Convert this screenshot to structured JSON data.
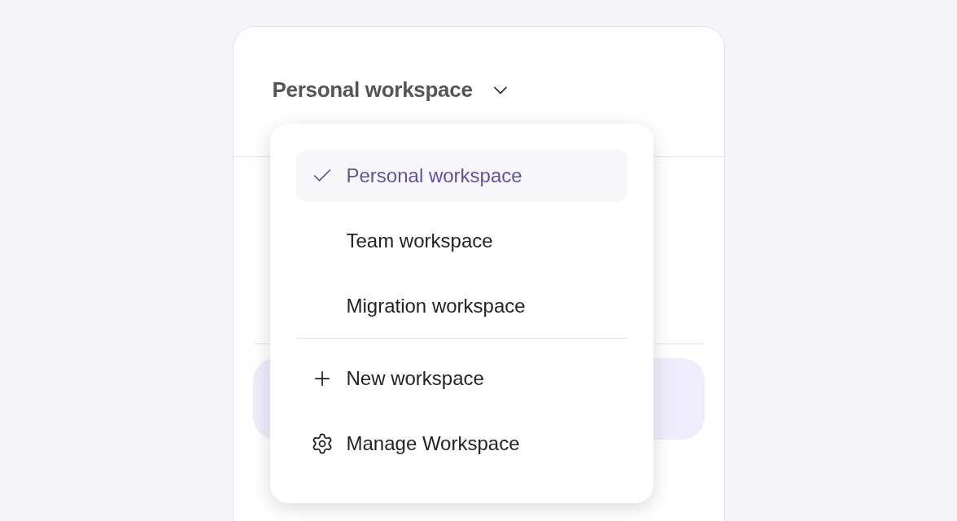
{
  "workspace_switcher": {
    "label": "Personal workspace",
    "expanded": true
  },
  "menu": {
    "workspaces": [
      {
        "label": "Personal workspace",
        "selected": true
      },
      {
        "label": "Team workspace",
        "selected": false
      },
      {
        "label": "Migration workspace",
        "selected": false
      }
    ],
    "actions": [
      {
        "label": "New workspace",
        "kind": "add"
      },
      {
        "label": "Manage Workspace",
        "kind": "settings"
      }
    ]
  }
}
